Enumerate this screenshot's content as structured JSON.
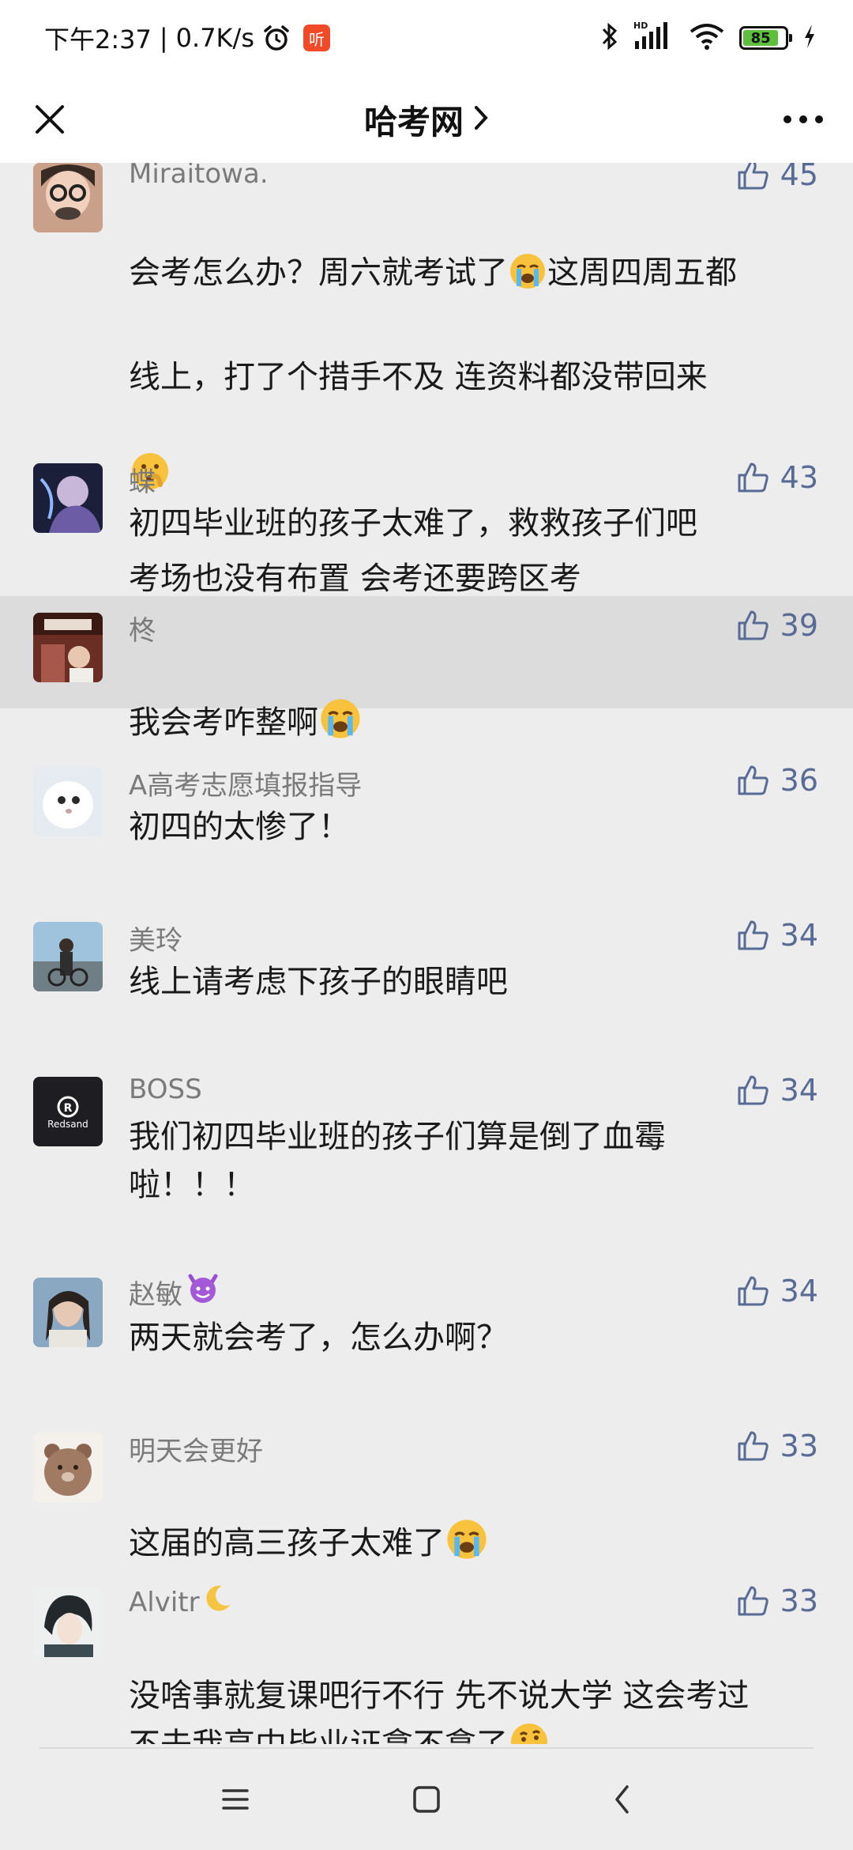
{
  "status_bar": {
    "time": "下午2:37",
    "network_speed": "0.7K/s",
    "app_badge": "听",
    "battery_level": "85",
    "battery_fraction": 0.85,
    "icons": [
      "alarm-clock-icon",
      "bluetooth-icon",
      "hd-signal-icon",
      "wifi-icon",
      "battery-icon",
      "charging-icon"
    ]
  },
  "nav": {
    "title": "哈考网",
    "title_chevron": "chevron-right-icon",
    "close_icon": "close-icon",
    "more_icon": "more-dots-icon"
  },
  "colors": {
    "background": "#ededed",
    "card_highlight": "#dcdcdc",
    "nickname": "#7a7a7a",
    "like": "#576b95",
    "text": "#1a1a1a"
  },
  "comments": [
    {
      "nickname": "Miraitowa.",
      "likes": "45",
      "text_line1": "会考怎么办？周六就考试了",
      "text_line1b": "这周四周五都",
      "text_line2": "线上，打了个措手不及 连资料都没带回来",
      "text_line4": "考场也没有布置 会考还要跨区考"
    },
    {
      "nickname": "蝶",
      "likes": "43",
      "text": "初四毕业班的孩子太难了，救救孩子们吧"
    },
    {
      "nickname": "柊",
      "likes": "39",
      "text": "我会考咋整啊"
    },
    {
      "nickname": "A高考志愿填报指导",
      "likes": "36",
      "text": "初四的太惨了！"
    },
    {
      "nickname": "美玲",
      "likes": "34",
      "text": "线上请考虑下孩子的眼睛吧"
    },
    {
      "nickname": "BOSS",
      "likes": "34",
      "text": "我们初四毕业班的孩子们算是倒了血霉\n啦！！！"
    },
    {
      "nickname": "赵敏",
      "likes": "34",
      "text": "两天就会考了，怎么办啊？"
    },
    {
      "nickname": "明天会更好",
      "likes": "33",
      "text": "这届的高三孩子太难了"
    },
    {
      "nickname": "Alvitr",
      "likes": "33",
      "text": "没啥事就复课吧行不行 先不说大学 这会考过\n不去我高中毕业证拿不拿了"
    }
  ],
  "avatar_badge_text": "Redsand",
  "system_nav": {
    "menu_icon": "menu-lines-icon",
    "home_icon": "home-square-icon",
    "back_icon": "back-chevron-icon"
  }
}
